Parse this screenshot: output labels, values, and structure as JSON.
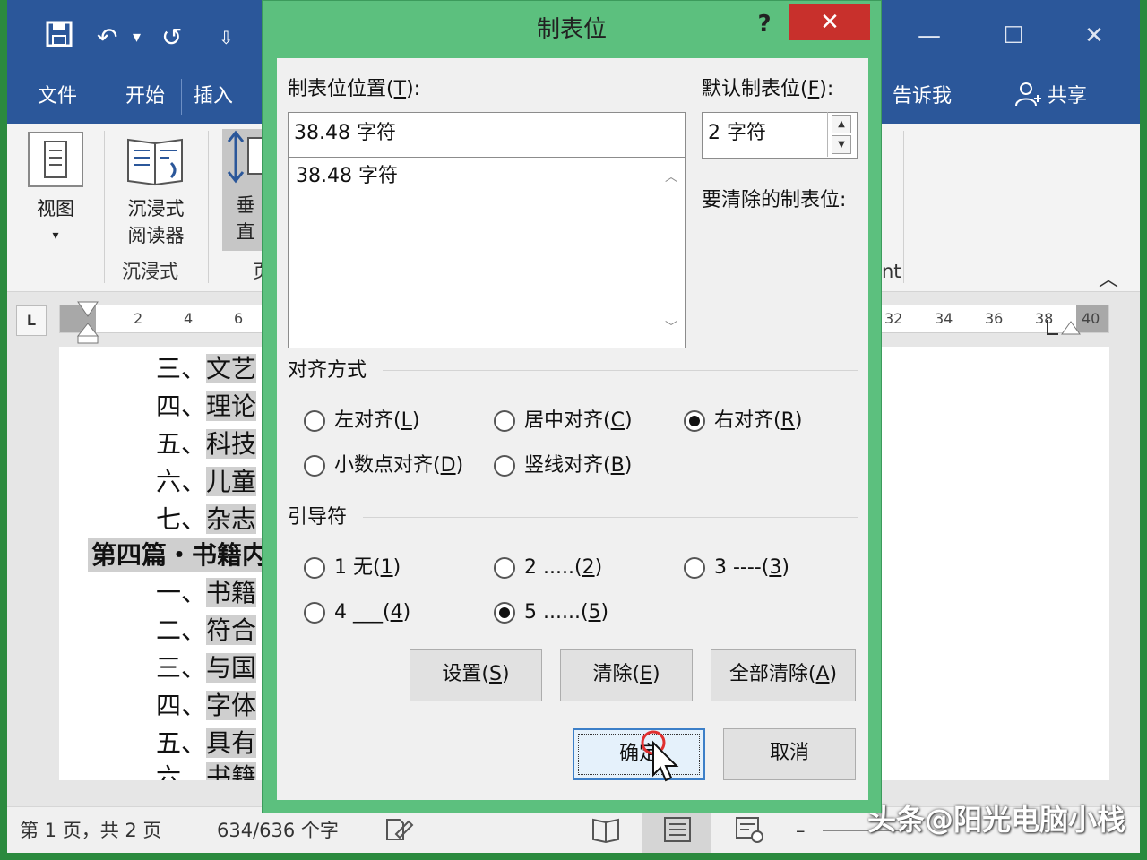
{
  "word": {
    "quick_access": {
      "save": "🖫",
      "undo": "↶",
      "undo_menu": "▾",
      "redo": "↺",
      "customize": "⇩"
    },
    "window_controls": {
      "minimize": "—",
      "restore": "☐",
      "close": "✕"
    },
    "tabs": {
      "file": "文件",
      "home": "开始",
      "insert": "插入",
      "tell_me": "告诉我",
      "share": "共享"
    },
    "ribbon": {
      "view_label": "视图",
      "view_arrow": "▾",
      "immersive_reader_line1": "沉浸式",
      "immersive_reader_line2": "阅读器",
      "immersive_group": "沉浸式",
      "vertical_partial1": "垂",
      "vertical_partial2": "直",
      "page_group_partial": "页",
      "group_partial_nt": "nt",
      "collapse": "︿"
    },
    "ruler": {
      "tab_selector": "L",
      "left_numbers": [
        "2",
        "4",
        "6"
      ],
      "right_numbers": [
        "32",
        "34",
        "36",
        "38",
        "40"
      ]
    },
    "document": {
      "lines": [
        {
          "prefix": "三、",
          "text": "文艺"
        },
        {
          "prefix": "四、",
          "text": "理论"
        },
        {
          "prefix": "五、",
          "text": "科技"
        },
        {
          "prefix": "六、",
          "text": "儿童"
        },
        {
          "prefix": "七、",
          "text": "杂志"
        },
        {
          "heading": "第四篇・书籍内"
        },
        {
          "prefix": "一、",
          "text": "书籍"
        },
        {
          "prefix": "二、",
          "text": "符合"
        },
        {
          "prefix": "三、",
          "text": "与国"
        },
        {
          "prefix": "四、",
          "text": "字体"
        },
        {
          "prefix": "五、",
          "text": "具有"
        },
        {
          "prefix": "六、",
          "text": "书籍"
        }
      ]
    },
    "status": {
      "page": "第 1 页，共 2 页",
      "words": "634/636 个字",
      "zoom_minus": "–"
    },
    "watermark": "头条@阳光电脑小栈"
  },
  "dialog": {
    "title": "制表位",
    "help": "?",
    "close": "✕",
    "tab_position_label": "制表位位置",
    "tab_position_key": "T",
    "tab_position_value": "38.48 字符",
    "tab_list": [
      "38.48 字符"
    ],
    "default_tab_label": "默认制表位",
    "default_tab_key": "F",
    "default_tab_value": "2 字符",
    "clear_label": "要清除的制表位:",
    "alignment_label": "对齐方式",
    "alignment": [
      {
        "label": "左对齐",
        "key": "L",
        "checked": false
      },
      {
        "label": "居中对齐",
        "key": "C",
        "checked": false
      },
      {
        "label": "右对齐",
        "key": "R",
        "checked": true
      },
      {
        "label": "小数点对齐",
        "key": "D",
        "checked": false
      },
      {
        "label": "竖线对齐",
        "key": "B",
        "checked": false
      }
    ],
    "leader_label": "引导符",
    "leaders": [
      {
        "label": "1 无",
        "key": "1",
        "checked": false
      },
      {
        "label": "2 .....",
        "key": "2",
        "checked": false
      },
      {
        "label": "3 ----",
        "key": "3",
        "checked": false
      },
      {
        "label": "4 ___",
        "key": "4",
        "checked": false
      },
      {
        "label": "5 ......",
        "key": "5",
        "checked": true
      }
    ],
    "buttons": {
      "set": {
        "label": "设置",
        "key": "S"
      },
      "clear": {
        "label": "清除",
        "key": "E"
      },
      "clear_all": {
        "label": "全部清除",
        "key": "A"
      },
      "ok": "确定",
      "cancel": "取消"
    }
  }
}
